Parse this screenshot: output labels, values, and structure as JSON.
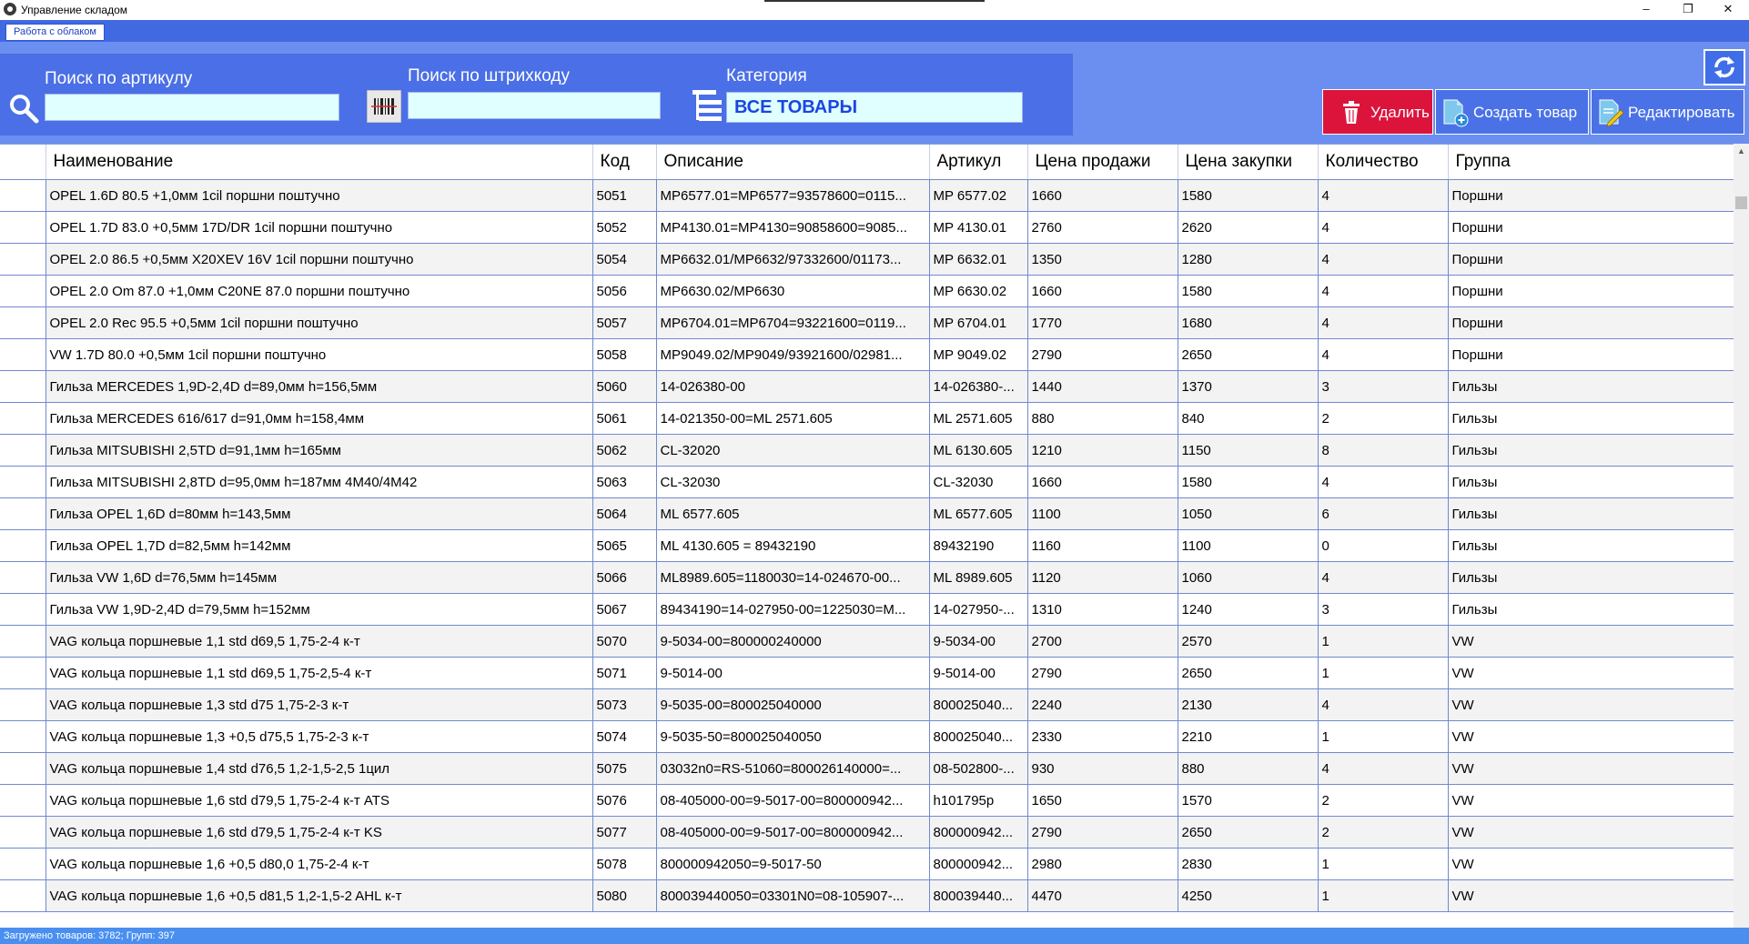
{
  "window": {
    "title": "Управление складом",
    "minimize": "–",
    "restore": "❐",
    "close": "✕"
  },
  "menu": {
    "cloud_tab": "Работа с облаком"
  },
  "search": {
    "article_label": "Поиск по артикулу",
    "article_value": "",
    "barcode_label": "Поиск по штрихкоду",
    "barcode_value": "",
    "category_label": "Категория",
    "category_value": "ВСЕ ТОВАРЫ"
  },
  "actions": {
    "delete": "Удалить",
    "create": "Создать товар",
    "edit": "Редактировать"
  },
  "table": {
    "columns": [
      "Наименование",
      "Код",
      "Описание",
      "Артикул",
      "Цена продажи",
      "Цена закупки",
      "Количество",
      "Группа"
    ],
    "rows": [
      [
        "OPEL 1.6D 80.5 +1,0мм 1cil поршни поштучно",
        "5051",
        "MP6577.01=MP6577=93578600=0115...",
        "MP 6577.02",
        "1660",
        "1580",
        "4",
        "Поршни"
      ],
      [
        "OPEL 1.7D 83.0 +0,5мм 17D/DR 1cil поршни поштучно",
        "5052",
        "MP4130.01=MP4130=90858600=9085...",
        "MP 4130.01",
        "2760",
        "2620",
        "4",
        "Поршни"
      ],
      [
        "OPEL 2.0 86.5 +0,5мм X20XEV 16V 1cil поршни поштучно",
        "5054",
        "MP6632.01/MP6632/97332600/01173...",
        "MP 6632.01",
        "1350",
        "1280",
        "4",
        "Поршни"
      ],
      [
        "OPEL 2.0 Om 87.0 +1,0мм C20NE 87.0 поршни поштучно",
        "5056",
        "MP6630.02/MP6630",
        "MP 6630.02",
        "1660",
        "1580",
        "4",
        "Поршни"
      ],
      [
        "OPEL 2.0 Rec 95.5 +0,5мм 1cil поршни поштучно",
        "5057",
        "MP6704.01=MP6704=93221600=0119...",
        "MP 6704.01",
        "1770",
        "1680",
        "4",
        "Поршни"
      ],
      [
        "VW 1.7D 80.0 +0,5мм 1cil поршни поштучно",
        "5058",
        "MP9049.02/MP9049/93921600/02981...",
        "MP 9049.02",
        "2790",
        "2650",
        "4",
        "Поршни"
      ],
      [
        "Гильза MERCEDES  1,9D-2,4D d=89,0мм h=156,5мм",
        "5060",
        "14-026380-00",
        "14-026380-...",
        "1440",
        "1370",
        "3",
        "Гильзы"
      ],
      [
        "Гильза MERCEDES  616/617 d=91,0мм h=158,4мм",
        "5061",
        "14-021350-00=ML 2571.605",
        "ML 2571.605",
        "880",
        "840",
        "2",
        "Гильзы"
      ],
      [
        "Гильза MITSUBISHI 2,5TD d=91,1мм h=165мм",
        "5062",
        "CL-32020",
        "ML 6130.605",
        "1210",
        "1150",
        "8",
        "Гильзы"
      ],
      [
        "Гильза MITSUBISHI 2,8TD d=95,0мм h=187мм 4M40/4M42",
        "5063",
        "CL-32030",
        "CL-32030",
        "1660",
        "1580",
        "4",
        "Гильзы"
      ],
      [
        "Гильза OPEL 1,6D d=80мм h=143,5мм",
        "5064",
        "ML 6577.605",
        "ML 6577.605",
        "1100",
        "1050",
        "6",
        "Гильзы"
      ],
      [
        "Гильза OPEL 1,7D d=82,5мм h=142мм",
        "5065",
        "ML 4130.605 = 89432190",
        "89432190",
        "1160",
        "1100",
        "0",
        "Гильзы"
      ],
      [
        "Гильза VW 1,6D d=76,5мм h=145мм",
        "5066",
        "ML8989.605=1180030=14-024670-00...",
        "ML 8989.605",
        "1120",
        "1060",
        "4",
        "Гильзы"
      ],
      [
        "Гильза VW 1,9D-2,4D d=79,5мм h=152мм",
        "5067",
        "89434190=14-027950-00=1225030=M...",
        "14-027950-...",
        "1310",
        "1240",
        "3",
        "Гильзы"
      ],
      [
        "VAG кольца поршневые 1,1 std d69,5  1,75-2-4 к-т",
        "5070",
        "9-5034-00=800000240000",
        "9-5034-00",
        "2700",
        "2570",
        "1",
        "VW"
      ],
      [
        "VAG кольца поршневые 1,1 std d69,5  1,75-2,5-4 к-т",
        "5071",
        "9-5014-00",
        "9-5014-00",
        "2790",
        "2650",
        "1",
        "VW"
      ],
      [
        "VAG кольца поршневые 1,3 std d75 1,75-2-3 к-т",
        "5073",
        "9-5035-00=800025040000",
        "800025040...",
        "2240",
        "2130",
        "4",
        "VW"
      ],
      [
        "VAG кольца поршневые 1,3 +0,5 d75,5 1,75-2-3 к-т",
        "5074",
        "9-5035-50=800025040050",
        "800025040...",
        "2330",
        "2210",
        "1",
        "VW"
      ],
      [
        "VAG кольца поршневые 1,4 std d76,5  1,2-1,5-2,5 1цил",
        "5075",
        "03032n0=RS-51060=800026140000=...",
        "08-502800-...",
        "930",
        "880",
        "4",
        "VW"
      ],
      [
        "VAG кольца поршневые 1,6 std d79,5  1,75-2-4 к-т ATS",
        "5076",
        "08-405000-00=9-5017-00=800000942...",
        "h101795p",
        "1650",
        "1570",
        "2",
        "VW"
      ],
      [
        "VAG кольца поршневые 1,6 std d79,5  1,75-2-4 к-т KS",
        "5077",
        "08-405000-00=9-5017-00=800000942...",
        "800000942...",
        "2790",
        "2650",
        "2",
        "VW"
      ],
      [
        "VAG кольца поршневые 1,6 +0,5 d80,0  1,75-2-4 к-т",
        "5078",
        "800000942050=9-5017-50",
        "800000942...",
        "2980",
        "2830",
        "1",
        "VW"
      ],
      [
        "VAG кольца поршневые 1,6 +0,5 d81,5 1,2-1,5-2 AHL к-т",
        "5080",
        "800039440050=03301N0=08-105907-...",
        "800039440...",
        "4470",
        "4250",
        "1",
        "VW"
      ]
    ]
  },
  "status": {
    "text": "Загружено товаров: 3782; Групп: 397"
  },
  "colors": {
    "accent": "#4169e1",
    "delete": "#dc143c",
    "field_bg": "#e0ffff",
    "category_text": "#1a46e0"
  }
}
